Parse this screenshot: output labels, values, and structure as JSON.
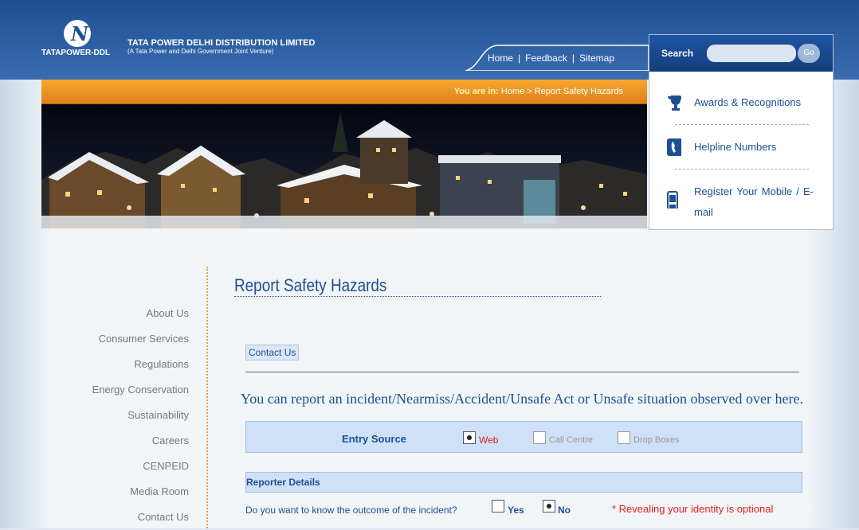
{
  "header": {
    "logo_brand": "TATAPOWER-DDL",
    "logo_glyph": "N",
    "company_name": "TATA POWER DELHI DISTRIBUTION LIMITED",
    "company_sub": "(A Tata Power and Delhi Government Joint Venture)"
  },
  "nav": {
    "home": "Home",
    "feedback": "Feedback",
    "sitemap": "Sitemap",
    "sep": "|"
  },
  "search": {
    "label": "Search",
    "placeholder": "",
    "go": "Go"
  },
  "breadcrumb": {
    "prefix": "You are in:",
    "path": "Home > Report Safety Hazards"
  },
  "quicklinks": [
    {
      "label": "Awards & Recognitions",
      "icon": "trophy-icon"
    },
    {
      "label": "Helpline Numbers",
      "icon": "phone-icon"
    },
    {
      "label": "Register Your Mobile / E-mail",
      "icon": "mobile-icon"
    }
  ],
  "sidemenu": [
    "About Us",
    "Consumer Services",
    "Regulations",
    "Energy Conservation",
    "Sustainability",
    "Careers",
    "CENPEID",
    "Media Room",
    "Contact Us"
  ],
  "page": {
    "title": "Report Safety Hazards",
    "contact_button": "Contact Us",
    "intro": "You can report an incident/Nearmiss/Accident/Unsafe Act or Unsafe situation observed over here."
  },
  "form": {
    "entry_source_label": "Entry Source",
    "entry_options": [
      "Web",
      "Call Centre",
      "Drop Boxes"
    ],
    "entry_selected": "Web",
    "reporter_section": "Reporter Details",
    "outcome_question": "Do you want to know the outcome of the incident?",
    "outcome_options": [
      "Yes",
      "No"
    ],
    "outcome_selected": "No",
    "identity_note": "* Revealing your identity is optional"
  },
  "colors": {
    "brand_blue": "#1d4f92",
    "orange": "#f5a830",
    "red_note": "#e02020"
  }
}
